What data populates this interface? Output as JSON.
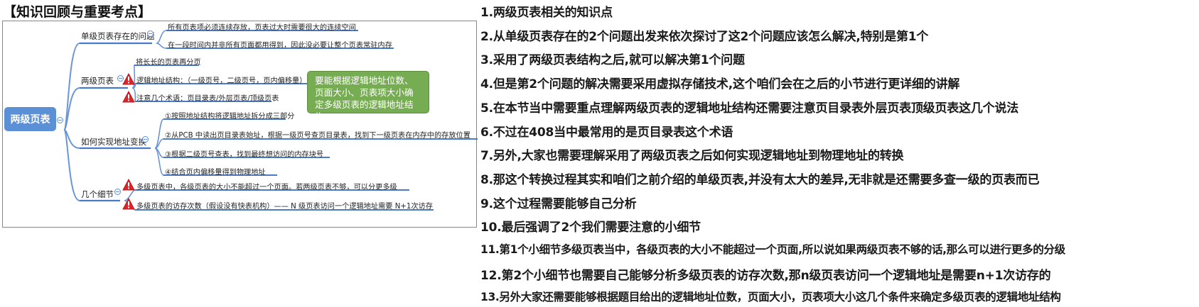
{
  "section_title": "【知识回顾与重要考点】",
  "mindmap": {
    "root": "两级页表",
    "branches": [
      {
        "label": "单级页表存在的问题",
        "children": [
          "所有页表项必须连续存放，页表过大时需要很大的连续空间",
          "在一段时间内并非所有页面都用得到，因此没必要让整个页表常驻内存"
        ]
      },
      {
        "label": "两级页表",
        "children": [
          "将长长的页表再分页",
          "逻辑地址结构：（一级页号，二级页号，页内偏移量）",
          "注意几个术语：页目录表/外层页表/顶级页表"
        ]
      },
      {
        "label": "如何实现地址变换",
        "children": [
          "①按照地址结构将逻辑地址拆分成三部分",
          "②从PCB 中读出页目录表始址，根据一级页号查页目录表，找到下一级页表在内存中的存放位置",
          "③根据二级页号查表，找到最终想访问的内存块号",
          "④结合页内偏移量得到物理地址"
        ]
      },
      {
        "label": "几个细节",
        "children": [
          "多级页表中，各级页表的大小不能超过一个页面。若两级页表不够，可以分更多级",
          "多级页表的访存次数（假设没有快表机构）—— N 级页表访问一个逻辑地址需要 N+1次访存"
        ]
      }
    ],
    "callout": "要能根据逻辑地址位数、页面大小、页表项大小确定多级页表的逻辑地址结构",
    "colors": {
      "root": "#5b8fd6",
      "connector": "#6a96d8",
      "underline": "#4a7bc8",
      "warning": "#d9262b",
      "callout": "#77ad52"
    }
  },
  "notes": [
    "1.两级页表相关的知识点",
    "2.从单级页表存在的2个问题出发来依次探讨了这2个问题应该怎么解决,特别是第1个",
    "3.采用了两级页表结构之后,就可以解决第1个问题",
    "4.但是第2个问题的解决需要采用虚拟存储技术,这个咱们会在之后的小节进行更详细的讲解",
    "5.在本节当中需要重点理解两级页表的逻辑地址结构还需要注意页目录表外层页表顶级页表这几个说法",
    "6.不过在408当中最常用的是页目录表这个术语",
    "7.另外,大家也需要理解采用了两级页表之后如何实现逻辑地址到物理地址的转换",
    "8.那这个转换过程其实和咱们之前介绍的单级页表,并没有太大的差异,无非就是还需要多查一级的页表而已",
    "9.这个过程需要能够自己分析",
    "10.最后强调了2个我们需要注意的小细节",
    "11.第1个小细节多级页表当中，各级页表的大小不能超过一个页面,所以说如果两级页表不够的话,那么可以进行更多的分级",
    "12.第2个小细节也需要自己能够分析多级页表的访存次数,那n级页表访问一个逻辑地址是需要n+1次访存的",
    "13.另外大家还需要能够根据题目给出的逻辑地址位数，页面大小，页表项大小这几个条件来确定多级页表的逻辑地址结构"
  ]
}
